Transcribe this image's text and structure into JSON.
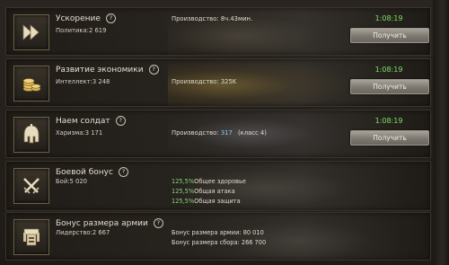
{
  "rows": [
    {
      "icon": "fast-forward-icon",
      "title": "Ускорение",
      "stat": "Политика:2 619",
      "info_label": "Производство:",
      "info_value": "8ч.43мин.",
      "timer": "1:08:19",
      "button": "Получить"
    },
    {
      "icon": "coins-icon",
      "title": "Развитие экономики",
      "stat": "Интеллект:3 248",
      "info_label": "Производство:",
      "info_value": "325K",
      "timer": "1:08:19",
      "button": "Получить"
    },
    {
      "icon": "spartan-helmet-icon",
      "title": "Наем солдат",
      "stat": "Харизма:3 171",
      "info_label": "Производство:",
      "info_value": "317",
      "info_extra": "(класс 4)",
      "timer": "1:08:19",
      "button": "Получить"
    },
    {
      "icon": "crossed-swords-icon",
      "title": "Боевой бонус",
      "stat": "Бой:5 020",
      "bonuses": [
        {
          "pct": "125,5%",
          "label": "Общее здоровье"
        },
        {
          "pct": "125,5%",
          "label": "Общая атака"
        },
        {
          "pct": "125,5%",
          "label": "Общая защита"
        }
      ]
    },
    {
      "icon": "army-banner-icon",
      "title": "Бонус размера армии",
      "stat": "Лидерство:2 667",
      "bonuses": [
        {
          "label": "Бонус размера армии:",
          "value": "80 010"
        },
        {
          "label": "Бонус размера сбора:",
          "value": "266 700"
        }
      ]
    }
  ],
  "help_glyph": "?",
  "colors": {
    "timer": "#7de06a",
    "percent": "#88d47a",
    "production_value": "#8ec8e8"
  }
}
